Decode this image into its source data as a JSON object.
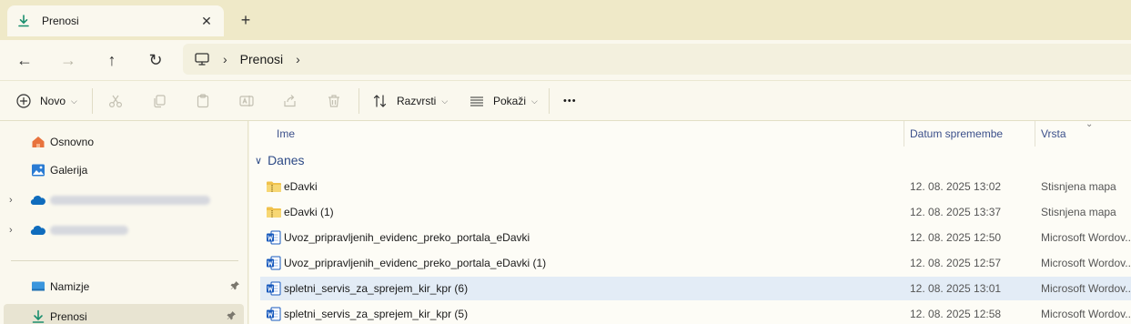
{
  "window": {
    "tab_title": "Prenosi",
    "tab_icon": "download-icon",
    "close_glyph": "✕",
    "new_tab_glyph": "+"
  },
  "navigation": {
    "back_glyph": "←",
    "forward_glyph": "→",
    "up_glyph": "↑",
    "refresh_glyph": "↻",
    "breadcrumb": [
      "Prenosi"
    ],
    "separator": "›"
  },
  "toolbar": {
    "new_label": "Novo",
    "sort_label": "Razvrsti",
    "view_label": "Pokaži",
    "more_glyph": "•••",
    "caret": "⌵"
  },
  "sidebar": {
    "items": [
      {
        "label": "Osnovno",
        "icon": "home-icon"
      },
      {
        "label": "Galerija",
        "icon": "gallery-icon"
      },
      {
        "label": "",
        "icon": "onedrive-icon",
        "blurred": true
      },
      {
        "label": "",
        "icon": "onedrive-icon",
        "blurred": true
      },
      {
        "label": "Namizje",
        "icon": "desktop-icon",
        "pinned": true
      },
      {
        "label": "Prenosi",
        "icon": "download-icon",
        "pinned": true,
        "selected": true
      }
    ],
    "expand_glyph": "›",
    "pin_glyph": "📌"
  },
  "list": {
    "columns": {
      "name": "Ime",
      "date": "Datum spremembe",
      "type": "Vrsta"
    },
    "sort_caret": "⌄",
    "group_label": "Danes",
    "group_chevron": "∨",
    "rows": [
      {
        "name": "eDavki",
        "date": "12. 08. 2025 13:02",
        "type": "Stisnjena mapa",
        "kind": "zip"
      },
      {
        "name": "eDavki (1)",
        "date": "12. 08. 2025 13:37",
        "type": "Stisnjena mapa",
        "kind": "zip"
      },
      {
        "name": "Uvoz_pripravljenih_evidenc_preko_portala_eDavki",
        "date": "12. 08. 2025 12:50",
        "type": "Microsoft Wordov...",
        "kind": "word"
      },
      {
        "name": "Uvoz_pripravljenih_evidenc_preko_portala_eDavki (1)",
        "date": "12. 08. 2025 12:57",
        "type": "Microsoft Wordov...",
        "kind": "word"
      },
      {
        "name": "spletni_servis_za_sprejem_kir_kpr (6)",
        "date": "12. 08. 2025 13:01",
        "type": "Microsoft Wordov...",
        "kind": "word",
        "selected": true
      },
      {
        "name": "spletni_servis_za_sprejem_kir_kpr (5)",
        "date": "12. 08. 2025 12:58",
        "type": "Microsoft Wordov...",
        "kind": "word"
      }
    ]
  },
  "colors": {
    "accent": "#0f6cbd",
    "folder": "#f0c14b",
    "word": "#185abd",
    "selected_row": "#e3ecf6"
  }
}
